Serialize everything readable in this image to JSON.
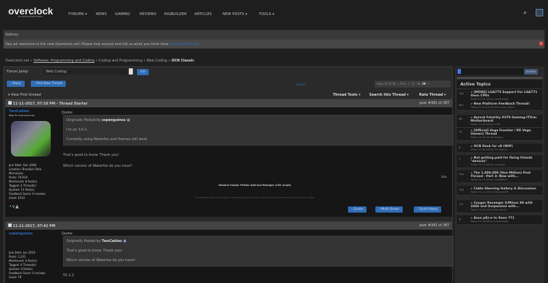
{
  "header": {
    "logo": "overclock",
    "tagline": "The pursuit of performance",
    "nav": [
      "FORUMS ▾",
      "NEWS",
      "GAMING",
      "REVIEWS",
      "RIGBUILDER",
      "ARTICLES",
      "NEW POSTS ▾",
      "TOOLS ▾"
    ]
  },
  "notice": {
    "title": "Notices",
    "message": "Hey all, welcome to the new Overclock.net! Please look around and tell us what you think here ",
    "link": "Feedback Thread"
  },
  "breadcrumb": [
    "Overclock.net",
    "Software, Programming and Coding",
    "Coding and Programming",
    "Web Coding",
    "OCN Classic"
  ],
  "forum_jump": {
    "label": "Forum Jump:",
    "value": "Web Coding",
    "go": "GO"
  },
  "actions": {
    "reply": "Reply",
    "new_thread": "Post New Thread",
    "search": "Search"
  },
  "pagination": {
    "text": "Page 39 of 39",
    "first": "« First",
    "prev": "<",
    "pages": [
      "37",
      "38",
      "39"
    ],
    "next": ">"
  },
  "thread": {
    "view_first_unread": "View First Unread",
    "tools": "Thread Tools ▾",
    "search": "Search this Thread ▾",
    "rate": "Rate Thread ▾"
  },
  "posts": [
    {
      "date": "11-11-2017, 07:10 PM",
      "tag": " - Thread Starter",
      "num": "post #381 of 387",
      "user": "TwoCables",
      "title": "New to Overclock.net",
      "info": [
        "Join Date: Dec 2008",
        "Location: Brooklyn Park,",
        "Minnesota",
        "Posts: 76,919",
        "Mentioned: 8 Post(s)",
        "Tagged: 4 Thread(s)",
        "Quoted: 13 Post(s)",
        "Feedback Score: 0 reviews",
        "Liked: 4212"
      ],
      "quote_label": "Quote:",
      "quote_by": "Originally Posted by",
      "quote_user": "sspenguinss",
      "quote_lines": [
        "I'm on 3.0.1.",
        "Currently using Waterfox and themes still work."
      ],
      "body": [
        "That's good to know. Thank you!",
        "Which version of Waterfox do you have?"
      ],
      "like": "Like",
      "sig_title": "Restore Classic Firefox Add-ons Manager (CSS script)",
      "sig_note": "The software spirit has no need for thankful approval; solving a certain conclusion that what has been done is right.",
      "buttons": [
        "Quote",
        "Multi-Quote",
        "Quick Reply"
      ]
    },
    {
      "date": "11-11-2017, 07:42 PM",
      "num": "post #382 of 387",
      "user": "sspenguinss",
      "info": [
        "Join Date: Jun 2010",
        "Posts: 1,241",
        "Mentioned: 0 Post(s)",
        "Tagged: 0 Thread(s)",
        "Quoted: 0 Post(s)",
        "Feedback Score: 0 reviews",
        "Liked: 79"
      ],
      "quote_label": "Quote:",
      "quote_by": "Originally Posted by",
      "quote_user": "TwoCables",
      "quote_lines": [
        "That's good to know. Thank you!",
        "Which version of Waterfox do you have?"
      ],
      "body": [
        "55.2.2"
      ]
    }
  ],
  "sidebar": {
    "search_button": "SEARCH",
    "title": "Active Topics",
    "topics": [
      {
        "count": "126",
        "title": "[MODE] LGA775 Support For LGA771 Xeon CPUs",
        "meta": "Today 01:18 AM by panatrosper"
      },
      {
        "count": "657",
        "title": "New Platform Feedback Thread!",
        "meta": "Today 01:19 AM by Overclock_Admin"
      },
      {
        "count": "86",
        "title": "Asrock Fatal1ty X370 Gaming-ITX/ac Motherboard",
        "meta": "Today 01:18 AM by 9378"
      },
      {
        "count": "76",
        "title": "[Official] Vega Frontier / RX Vega Owners Thread",
        "meta": "Today 01:18 AM by Dasans"
      },
      {
        "count": "8",
        "title": "OCN Dusk for v8 (WIP)",
        "meta": "Today 01:18 AM by TTL Replica"
      },
      {
        "count": "3",
        "title": "Not getting paid for fixing friends \"devices\"",
        "meta": "Today 01:13 AM by christopk"
      },
      {
        "count": "226",
        "title": "The 1,000,000 (One Million) Post Thread - Part 3: Now with...",
        "meta": "Today 01:13 AM by ncdaRefer2"
      },
      {
        "count": "108",
        "title": "Cable Sleeving Gallery & Discussion",
        "meta": "Today 01:11 AM by HardcoreSFL"
      },
      {
        "count": "211",
        "title": "Cougar Revenger S/Minos X8 with 3360 and Surpassion with...",
        "meta": "Today 01:01 AM by Danzein2k"
      },
      {
        "count": "8",
        "title": "Asus p8z-e to Xeon 771",
        "meta": "Today 01:16 AM by panatrosper"
      }
    ]
  }
}
